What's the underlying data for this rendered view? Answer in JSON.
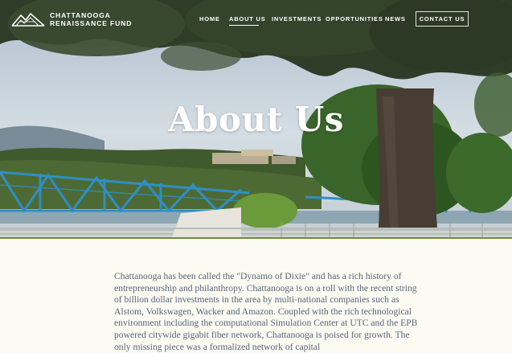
{
  "brand": {
    "line1": "CHATTANOOGA",
    "line2": "RENAISSANCE FUND",
    "logo_icon": "mountain-logo-icon"
  },
  "nav": {
    "items": [
      {
        "label": "HOME"
      },
      {
        "label": "ABOUT US",
        "active": true
      },
      {
        "label": "INVESTMENTS"
      },
      {
        "label": "OPPORTUNITIES"
      },
      {
        "label": "NEWS"
      }
    ],
    "contact_label": "CONTACT US"
  },
  "hero": {
    "title": "About Us"
  },
  "content": {
    "intro": "Chattanooga has been called the \"Dynamo of Dixie\" and has a rich history of entrepreneurship and philanthropy. Chattanooga is on a roll with the recent string of billion dollar investments in the area by multi-national companies such as Alstom, Volkswagen, Wacker and Amazon. Coupled with the rich technological environment including the computational Simulation Center at UTC and the EPB powered citywide gigabit fiber network, Chattanooga is poised for growth. The only missing piece was a formalized network of capital"
  },
  "colors": {
    "accent_rule": "#6f8d43",
    "body_text": "#5a6675",
    "page_bg": "#fbfaf3",
    "bridge": "#2f8fc4"
  }
}
